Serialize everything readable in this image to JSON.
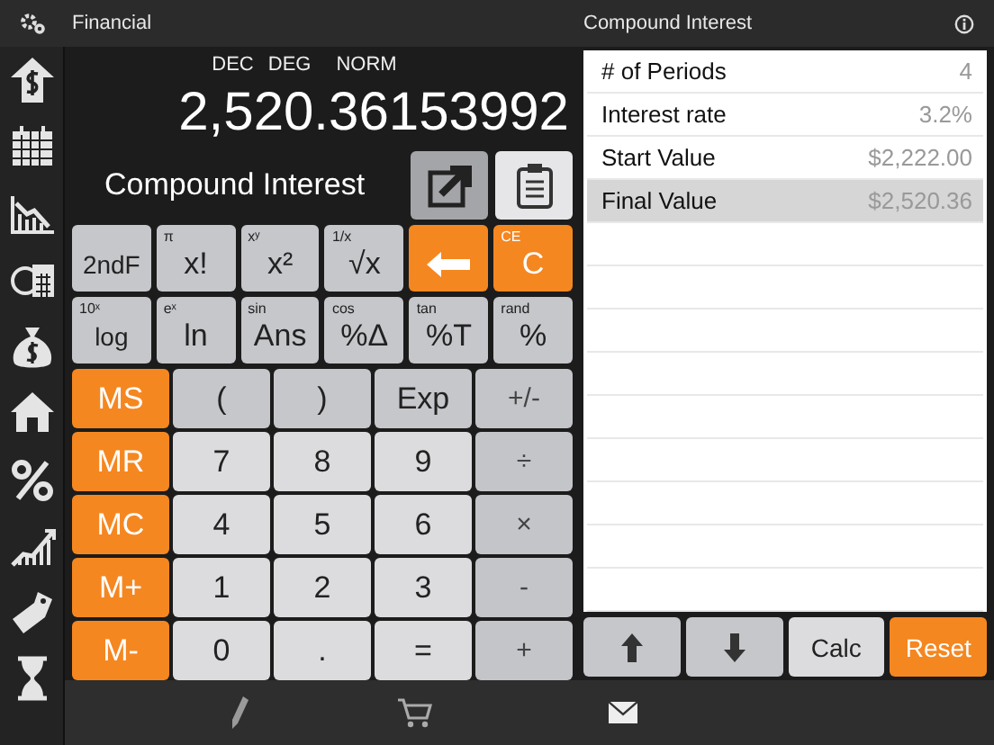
{
  "top_bar": {
    "title": "Financial"
  },
  "modes": [
    "DEC",
    "DEG",
    "NORM"
  ],
  "display": "2,520.36153992",
  "calc_title": "Compound Interest",
  "key_rows": [
    [
      {
        "label": "2ndF",
        "kind": "function"
      },
      {
        "label": "x!",
        "sup": "π",
        "kind": "function"
      },
      {
        "label": "x²",
        "sup": "xʸ",
        "kind": "function"
      },
      {
        "label": "√x",
        "sup": "1/x",
        "kind": "function"
      },
      {
        "kind": "backspace"
      },
      {
        "label": "C",
        "sup": "CE",
        "kind": "accent"
      }
    ],
    [
      {
        "label": "log",
        "sup": "10ˣ",
        "kind": "function"
      },
      {
        "label": "ln",
        "sup": "eˣ",
        "kind": "function"
      },
      {
        "label": "Ans",
        "sup": "sin",
        "kind": "function"
      },
      {
        "label": "%Δ",
        "sup": "cos",
        "kind": "function"
      },
      {
        "label": "%T",
        "sup": "tan",
        "kind": "function"
      },
      {
        "label": "%",
        "sup": "rand",
        "kind": "function"
      }
    ],
    [
      {
        "label": "MS",
        "kind": "accent"
      },
      {
        "label": "(",
        "kind": "function"
      },
      {
        "label": ")",
        "kind": "function"
      },
      {
        "label": "Exp",
        "kind": "function"
      },
      {
        "label": "+/-",
        "kind": "operator"
      }
    ],
    [
      {
        "label": "MR",
        "kind": "accent"
      },
      {
        "label": "7",
        "kind": "digit"
      },
      {
        "label": "8",
        "kind": "digit"
      },
      {
        "label": "9",
        "kind": "digit"
      },
      {
        "label": "÷",
        "kind": "operator"
      }
    ],
    [
      {
        "label": "MC",
        "kind": "accent"
      },
      {
        "label": "4",
        "kind": "digit"
      },
      {
        "label": "5",
        "kind": "digit"
      },
      {
        "label": "6",
        "kind": "digit"
      },
      {
        "label": "×",
        "kind": "operator"
      }
    ],
    [
      {
        "label": "M+",
        "kind": "accent"
      },
      {
        "label": "1",
        "kind": "digit"
      },
      {
        "label": "2",
        "kind": "digit"
      },
      {
        "label": "3",
        "kind": "digit"
      },
      {
        "label": "-",
        "kind": "operator"
      }
    ],
    [
      {
        "label": "M-",
        "kind": "accent"
      },
      {
        "label": "0",
        "kind": "digit"
      },
      {
        "label": ".",
        "kind": "digit"
      },
      {
        "label": "=",
        "kind": "digit"
      },
      {
        "label": "+",
        "kind": "operator"
      }
    ]
  ],
  "panel": {
    "title": "Compound Interest",
    "rows": [
      {
        "label": "# of Periods",
        "value": "4",
        "selected": false
      },
      {
        "label": "Interest rate",
        "value": "3.2%",
        "selected": false
      },
      {
        "label": "Start Value",
        "value": "$2,222.00",
        "selected": false
      },
      {
        "label": "Final Value",
        "value": "$2,520.36",
        "selected": true
      }
    ],
    "buttons": [
      {
        "kind": "up"
      },
      {
        "kind": "down"
      },
      {
        "label": "Calc",
        "kind": "plain"
      },
      {
        "label": "Reset",
        "kind": "accent"
      }
    ]
  }
}
